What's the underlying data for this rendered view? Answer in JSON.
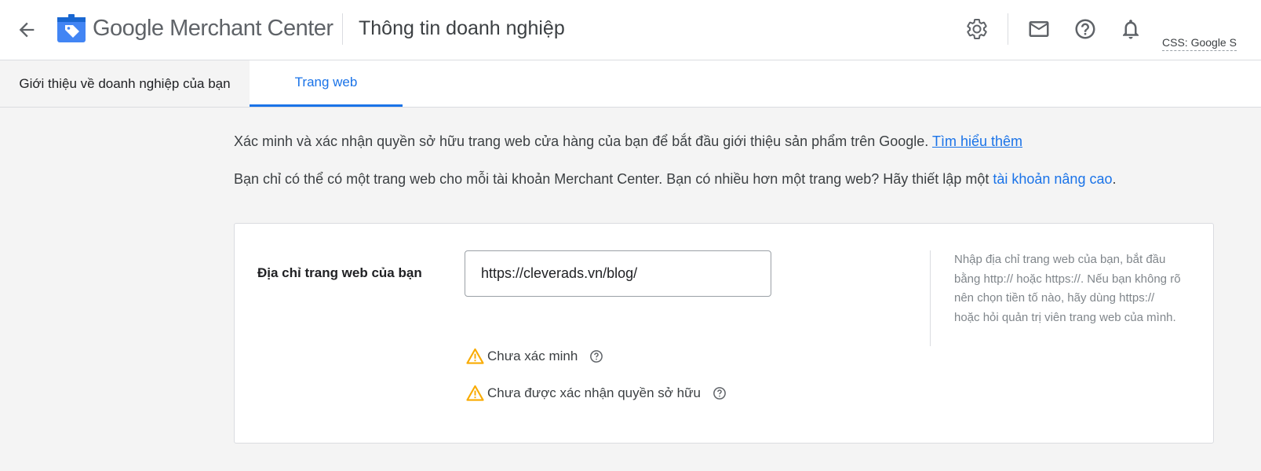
{
  "header": {
    "brand_google": "Google",
    "brand_product": "Merchant Center",
    "page_title": "Thông tin doanh nghiệp",
    "css_label": "CSS: Google S"
  },
  "tabs": {
    "about_label": "Giới thiệu về doanh nghiệp của bạn",
    "website_label": "Trang web"
  },
  "intro": {
    "line1_text": "Xác minh và xác nhận quyền sở hữu trang web cửa hàng của bạn để bắt đầu giới thiệu sản phẩm trên Google.",
    "line1_link": "Tìm hiểu thêm",
    "line2_text": "Bạn chỉ có thể có một trang web cho mỗi tài khoản Merchant Center. Bạn có nhiều hơn một trang web? Hãy thiết lập một",
    "line2_link": "tài khoản nâng cao",
    "line2_end": "."
  },
  "website_card": {
    "field_label": "Địa chỉ trang web của bạn",
    "url_value": "https://cleverads.vn/blog/",
    "help_text": "Nhập địa chỉ trang web của bạn, bắt đầu bằng http:// hoặc https://. Nếu bạn không rõ nên chọn tiền tố nào, hãy dùng https:// hoặc hỏi quản trị viên trang web của mình.",
    "status_unverified": "Chưa xác minh",
    "status_unclaimed": "Chưa được xác nhận quyền sở hữu"
  },
  "colors": {
    "accent": "#1a73e8",
    "warning": "#f9ab00",
    "background": "#f4f4f4"
  },
  "icons": [
    "back-arrow-icon",
    "merchant-center-logo-icon",
    "settings-gear-icon",
    "mail-icon",
    "help-icon",
    "notifications-bell-icon",
    "warning-icon",
    "question-circle-icon"
  ]
}
